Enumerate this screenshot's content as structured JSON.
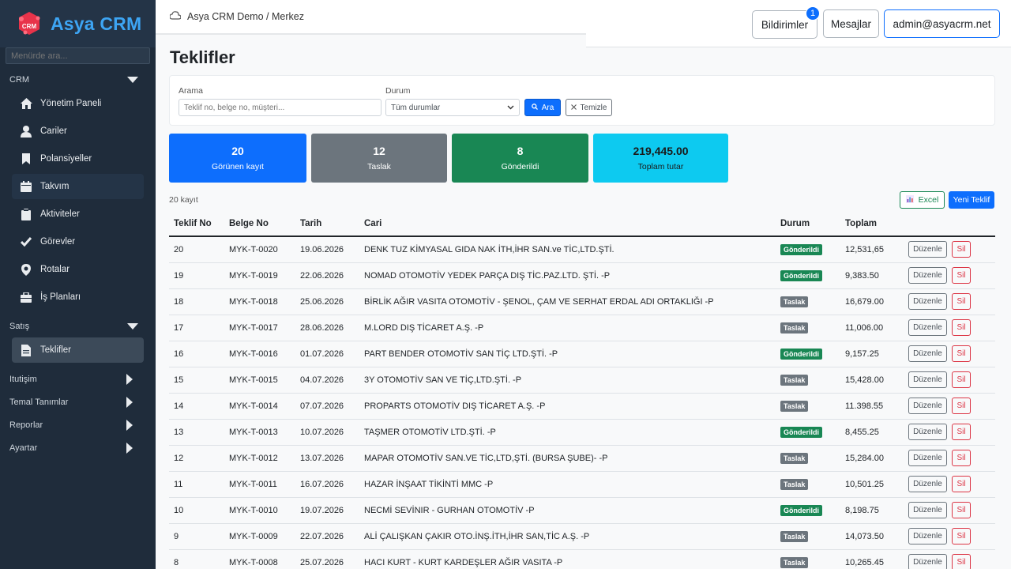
{
  "app": {
    "name": "Asya CRM"
  },
  "sidebar": {
    "search_placeholder": "Menürde ara...",
    "sections": {
      "crm": "CRM",
      "satis": "Satış",
      "iletisim": "Itutişim",
      "temel": "Temal Tanımlar",
      "raporlar": "Reporlar",
      "ayarlar": "Ayartar"
    },
    "items": [
      {
        "label": "Yönetim Paneli",
        "icon": "home-icon"
      },
      {
        "label": "Cariler",
        "icon": "user-icon"
      },
      {
        "label": "Polansiyeller",
        "icon": "bookmark-icon"
      },
      {
        "label": "Takvım",
        "icon": "calendar-icon"
      },
      {
        "label": "Aktiviteler",
        "icon": "clipboard-icon"
      },
      {
        "label": "Görevler",
        "icon": "check-icon"
      },
      {
        "label": "Rotalar",
        "icon": "map-pin-icon"
      },
      {
        "label": "İş Planları",
        "icon": "briefcase-icon"
      },
      {
        "label": "Teklifler",
        "icon": "document-icon"
      }
    ]
  },
  "header": {
    "breadcrumb": "Asya CRM Demo / Merkez",
    "notifications_label": "Bildirimler",
    "notifications_count": "1",
    "messages_label": "Mesajlar",
    "user_label": "admin@asyacrm.net"
  },
  "page": {
    "title": "Teklifler",
    "filters": {
      "search_label": "Arama",
      "search_placeholder": "Teklif no, belge no, müşteri...",
      "status_label": "Durum",
      "status_value": "Tüm durumlar",
      "search_button": "Ara",
      "clear_button": "Temizle"
    },
    "stats": [
      {
        "value": "20",
        "label": "Görünen kayıt",
        "color": "#0d6efd"
      },
      {
        "value": "12",
        "label": "Taslak",
        "color": "#6c757d"
      },
      {
        "value": "8",
        "label": "Gönderildi",
        "color": "#198754"
      },
      {
        "value": "219,445.00",
        "label": "Toplam tutar",
        "color": "#0dcaf0"
      }
    ],
    "record_count": "20 kayıt",
    "excel_button": "Excel",
    "new_button": "Yeni Teklif"
  },
  "table": {
    "headers": [
      "Teklif No",
      "Belge No",
      "Tarih",
      "Cari",
      "Durum",
      "Toplam"
    ],
    "edit_label": "Düzenle",
    "delete_label": "Sil",
    "rows": [
      {
        "no": "20",
        "doc": "MYK-T-0020",
        "date": "19.06.2026",
        "cari": "DENK TUZ KİMYASAL GIDA NAK İTH,İHR SAN.ve TİC,LTD.ŞTİ.",
        "status": "Gönderildi",
        "status_type": "sent",
        "total": "12,531,65"
      },
      {
        "no": "19",
        "doc": "MYK-T-0019",
        "date": "22.06.2026",
        "cari": "NOMAD OTOMOTİV YEDEK PARÇA DIŞ TİC.PAZ.LTD. ŞTİ. -P",
        "status": "Gönderildi",
        "status_type": "sent",
        "total": "9,383.50"
      },
      {
        "no": "18",
        "doc": "MYK-T-0018",
        "date": "25.06.2026",
        "cari": "BİRLİK AĞIR VASITA OTOMOTİV - ŞENOL, ÇAM VE SERHAT ERDAL ADI ORTAKLIĞI -P",
        "status": "Taslak",
        "status_type": "draft",
        "total": "16,679.00"
      },
      {
        "no": "17",
        "doc": "MYK-T-0017",
        "date": "28.06.2026",
        "cari": "M.LORD DIŞ TİCARET A.Ş. -P",
        "status": "Taslak",
        "status_type": "draft",
        "total": "11,006.00"
      },
      {
        "no": "16",
        "doc": "MYK-T-0016",
        "date": "01.07.2026",
        "cari": "PART BENDER OTOMOTİV SAN TİÇ LTD.ŞTİ. -P",
        "status": "Gönderildi",
        "status_type": "sent",
        "total": "9,157.25"
      },
      {
        "no": "15",
        "doc": "MYK-T-0015",
        "date": "04.07.2026",
        "cari": "3Y OTOMOTİV SAN VE TİÇ,LTD.ŞTİ. -P",
        "status": "Taslak",
        "status_type": "draft",
        "total": "15,428.00"
      },
      {
        "no": "14",
        "doc": "MYK-T-0014",
        "date": "07.07.2026",
        "cari": "PROPARTS OTOMOTİV DIŞ TİCARET A.Ş. -P",
        "status": "Taslak",
        "status_type": "draft",
        "total": "11.398.55"
      },
      {
        "no": "13",
        "doc": "MYK-T-0013",
        "date": "10.07.2026",
        "cari": "TAŞMER OTOMOTİV LTD.ŞTİ. -P",
        "status": "Gönderildi",
        "status_type": "sent",
        "total": "8,455.25"
      },
      {
        "no": "12",
        "doc": "MYK-T-0012",
        "date": "13.07.2026",
        "cari": "MAPAR OTOMOTİV SAN.VE TİC,LTD,ŞTİ. (BURSA ŞUBE)- -P",
        "status": "Taslak",
        "status_type": "draft",
        "total": "15,284.00"
      },
      {
        "no": "11",
        "doc": "MYK-T-0011",
        "date": "16.07.2026",
        "cari": "HAZAR İNŞAAT TİKİNTİ MMC -P",
        "status": "Taslak",
        "status_type": "draft",
        "total": "10,501.25"
      },
      {
        "no": "10",
        "doc": "MYK-T-0010",
        "date": "19.07.2026",
        "cari": "NECMİ SEVİNIR - GURHAN OTOMOTİV -P",
        "status": "Gönderildi",
        "status_type": "sent",
        "total": "8,198.75"
      },
      {
        "no": "9",
        "doc": "MYK-T-0009",
        "date": "22.07.2026",
        "cari": "ALİ ÇALIŞKAN ÇAKIR OTO.İNŞ.İTH,İHR SAN,TİC A.Ş. -P",
        "status": "Taslak",
        "status_type": "draft",
        "total": "14,073.50"
      },
      {
        "no": "8",
        "doc": "MYK-T-0008",
        "date": "25.07.2026",
        "cari": "HACI KURT - KURT KARDEŞLER AĞIR VASITA -P",
        "status": "Taslak",
        "status_type": "draft",
        "total": "10,265.45"
      }
    ]
  }
}
